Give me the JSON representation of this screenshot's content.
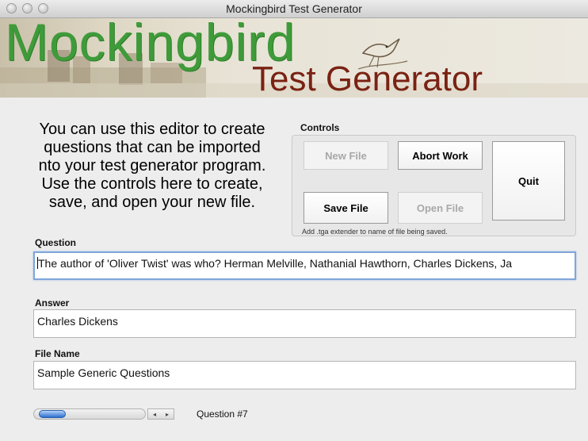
{
  "window": {
    "title": "Mockingbird Test Generator"
  },
  "banner": {
    "title": "Mockingbird",
    "subtitle": "Test Generator"
  },
  "intro": {
    "lines": [
      "You can use this editor to create",
      "questions that can be imported",
      "nto your test generator program.",
      "Use the controls here to create,",
      "save, and open your new file."
    ]
  },
  "controls": {
    "label": "Controls",
    "new_file": "New File",
    "abort_work": "Abort Work",
    "quit": "Quit",
    "save_file": "Save File",
    "open_file": "Open File",
    "hint": "Add .tga extender to name of file being saved."
  },
  "question": {
    "label": "Question",
    "value": "The author of 'Oliver Twist' was who? Herman Melville, Nathanial Hawthorn, Charles Dickens, Ja"
  },
  "answer": {
    "label": "Answer",
    "value": "Charles Dickens"
  },
  "filename": {
    "label": "File Name",
    "value": "Sample Generic Questions"
  },
  "navigator": {
    "status": "Question #7"
  },
  "icons": {
    "prev": "◂",
    "next": "▸"
  }
}
